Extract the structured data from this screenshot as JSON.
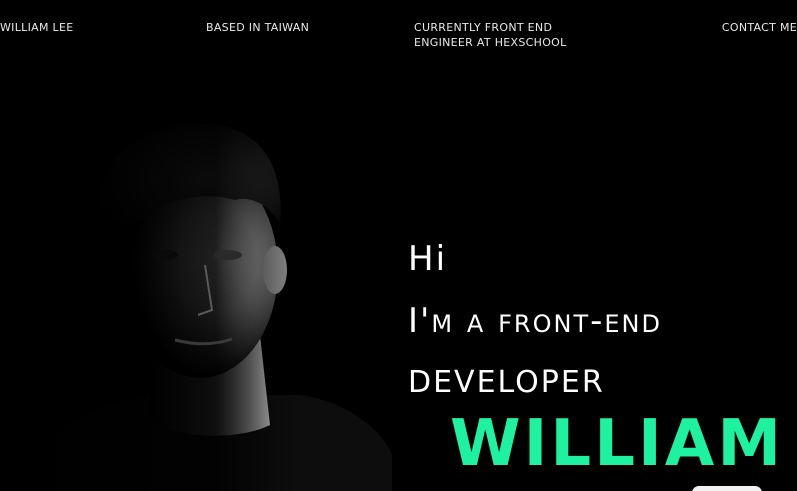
{
  "nav": {
    "name": "WILLIAM LEE",
    "location": "BASED IN TAIWAN",
    "role_line1": "CURRENTLY FRONT END",
    "role_line2": "ENGINEER AT HEXSCHOOL",
    "contact": "CONTACT ME"
  },
  "hero": {
    "greeting": "Hi",
    "intro": "I'm a front-end",
    "role": "developer",
    "name": "William"
  },
  "colors": {
    "background": "#000000",
    "text": "#ffffff",
    "accent": "#1ef2a0"
  }
}
